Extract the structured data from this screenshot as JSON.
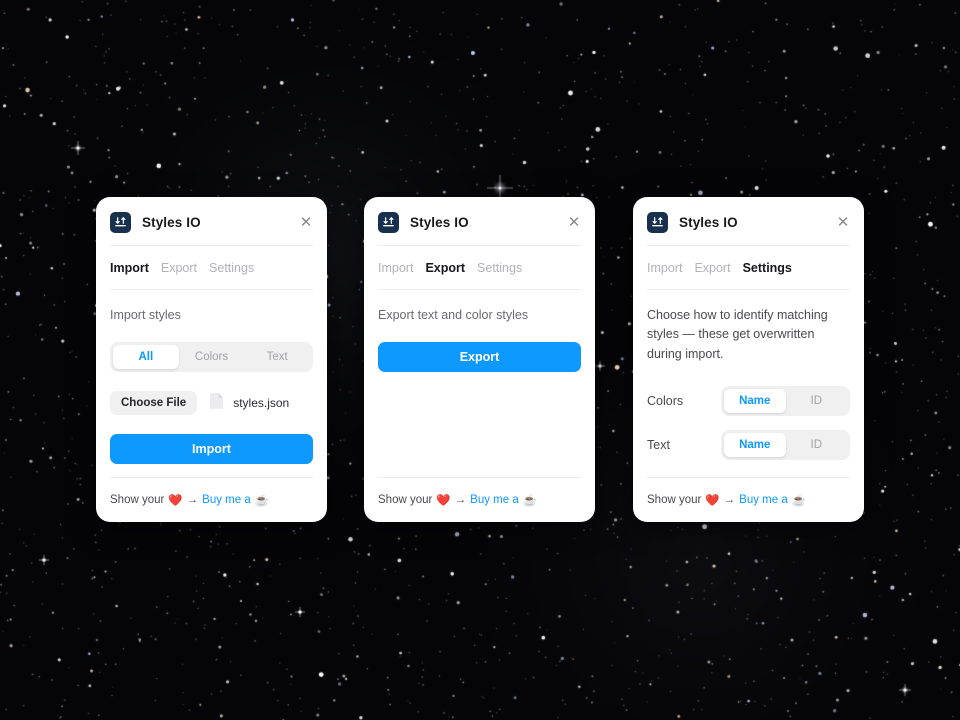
{
  "app": {
    "title": "Styles IO",
    "logo_icon": "import-export-icon",
    "close_icon": "close-icon",
    "accent_color": "#0D99FF",
    "logo_bg_color": "#17304D"
  },
  "footer": {
    "prefix": "Show your",
    "heart_emoji": "❤️",
    "arrow": "→",
    "link": "Buy me a",
    "coffee_emoji": "☕"
  },
  "tabs": {
    "import": "Import",
    "export": "Export",
    "settings": "Settings"
  },
  "panels": [
    {
      "id": "import",
      "active_tab": "Import",
      "section_label": "Import styles",
      "segmented": {
        "options": [
          "All",
          "Colors",
          "Text"
        ],
        "selected": "All"
      },
      "file_row": {
        "button_label": "Choose File",
        "file_icon": "file-icon",
        "file_name": "styles.json"
      },
      "primary_button": "Import"
    },
    {
      "id": "export",
      "active_tab": "Export",
      "section_label": "Export text and color styles",
      "primary_button": "Export"
    },
    {
      "id": "settings",
      "active_tab": "Settings",
      "description": "Choose how to identify matching styles — these get overwritten during import.",
      "rows": [
        {
          "label": "Colors",
          "options": [
            "Name",
            "ID"
          ],
          "selected": "Name"
        },
        {
          "label": "Text",
          "options": [
            "Name",
            "ID"
          ],
          "selected": "Name"
        }
      ]
    }
  ]
}
